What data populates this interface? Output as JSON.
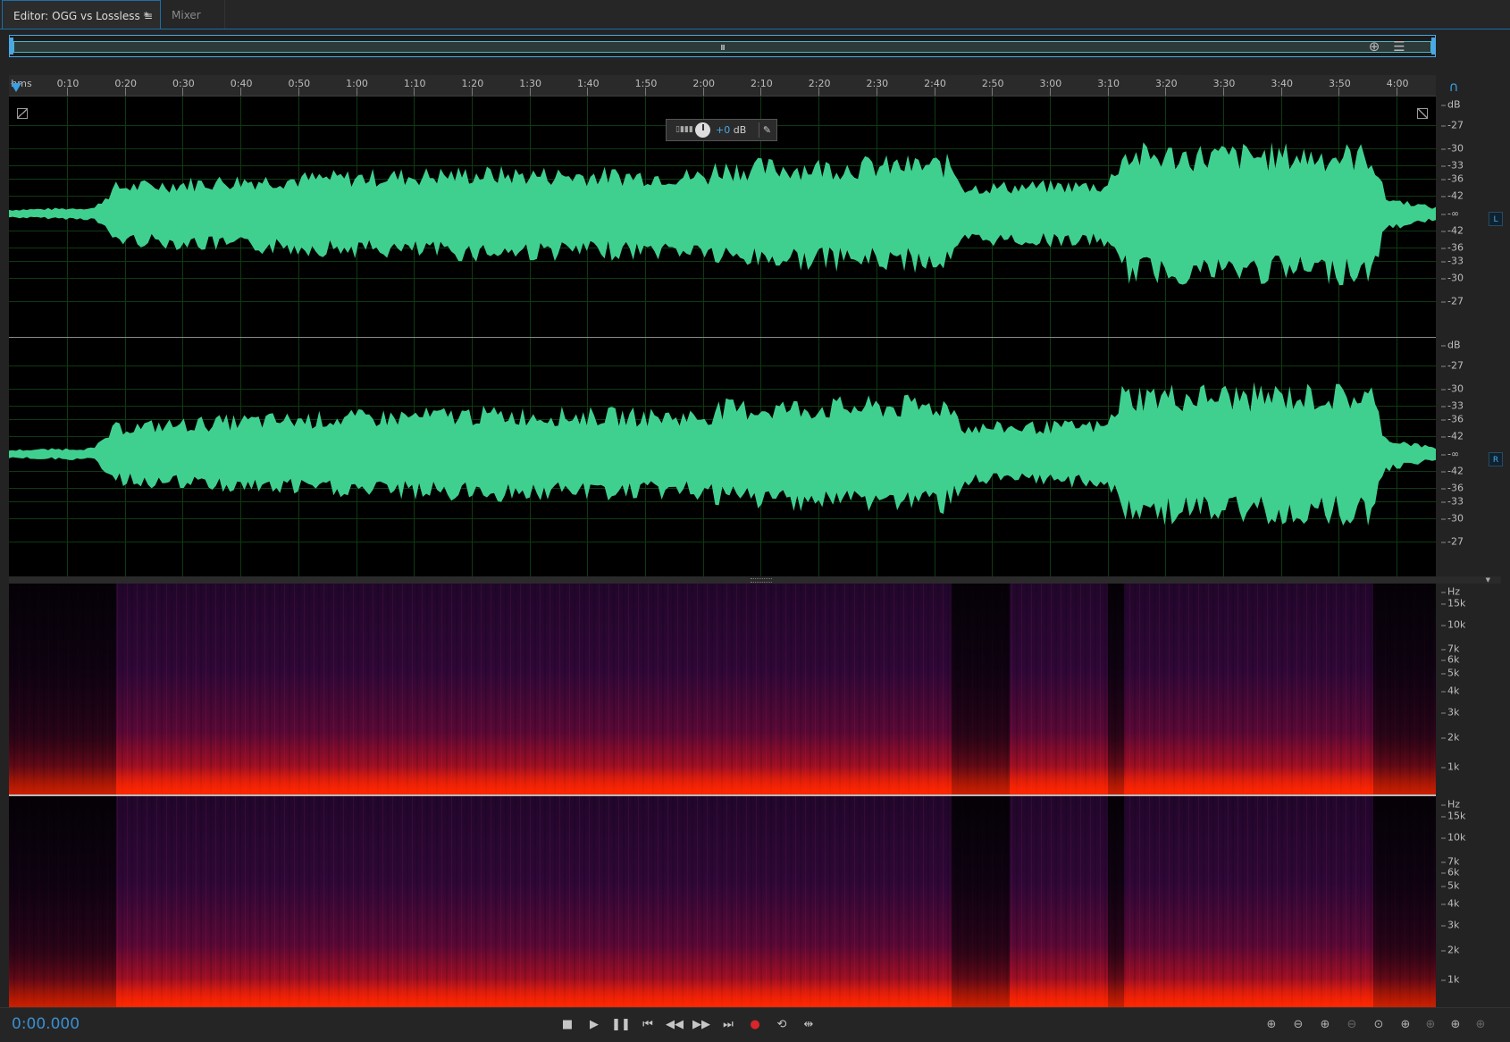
{
  "tabs": {
    "editor_label": "Editor: OGG vs Lossless *",
    "editor_menu_icon": "≡",
    "mixer_label": "Mixer"
  },
  "overview": {
    "grip": "III"
  },
  "ruler": {
    "unit": "hms",
    "ticks": [
      "0:10",
      "0:20",
      "0:30",
      "0:40",
      "0:50",
      "1:00",
      "1:10",
      "1:20",
      "1:30",
      "1:40",
      "1:50",
      "2:00",
      "2:10",
      "2:20",
      "2:30",
      "2:40",
      "2:50",
      "3:00",
      "3:10",
      "3:20",
      "3:30",
      "3:40",
      "3:50",
      "4:00"
    ]
  },
  "hud": {
    "meter": "▯▮▮▮",
    "value": "+0",
    "unit": " dB"
  },
  "db_scale": {
    "unit": "dB",
    "labels": [
      "-27",
      "-30",
      "-33",
      "-36",
      "-42",
      "-∞",
      "-42",
      "-36",
      "-33",
      "-30",
      "-27"
    ]
  },
  "channels": {
    "left": "L",
    "right": "R"
  },
  "hz_scale": {
    "unit": "Hz",
    "labels": [
      "15k",
      "10k",
      "7k",
      "6k",
      "5k",
      "4k",
      "3k",
      "2k",
      "1k"
    ]
  },
  "transport": {
    "timecode": "0:00.000",
    "buttons": [
      "stop",
      "play",
      "pause",
      "go-to-start",
      "rewind",
      "fast-forward",
      "go-to-end",
      "record",
      "loop",
      "skip-selection"
    ],
    "record_color": "#d9262b"
  },
  "zoom_buttons": [
    "zoom-in-amplitude",
    "zoom-out-amplitude",
    "zoom-in-time",
    "zoom-out-time",
    "zoom-out-full",
    "zoom-in-selection",
    "zoom-left-selection",
    "zoom-right-selection",
    "zoom-in-selection-full",
    "zoom-out-selection-full"
  ],
  "colors": {
    "accent": "#3a8fd0",
    "waveform": "#3fd08f",
    "background": "#000000"
  }
}
